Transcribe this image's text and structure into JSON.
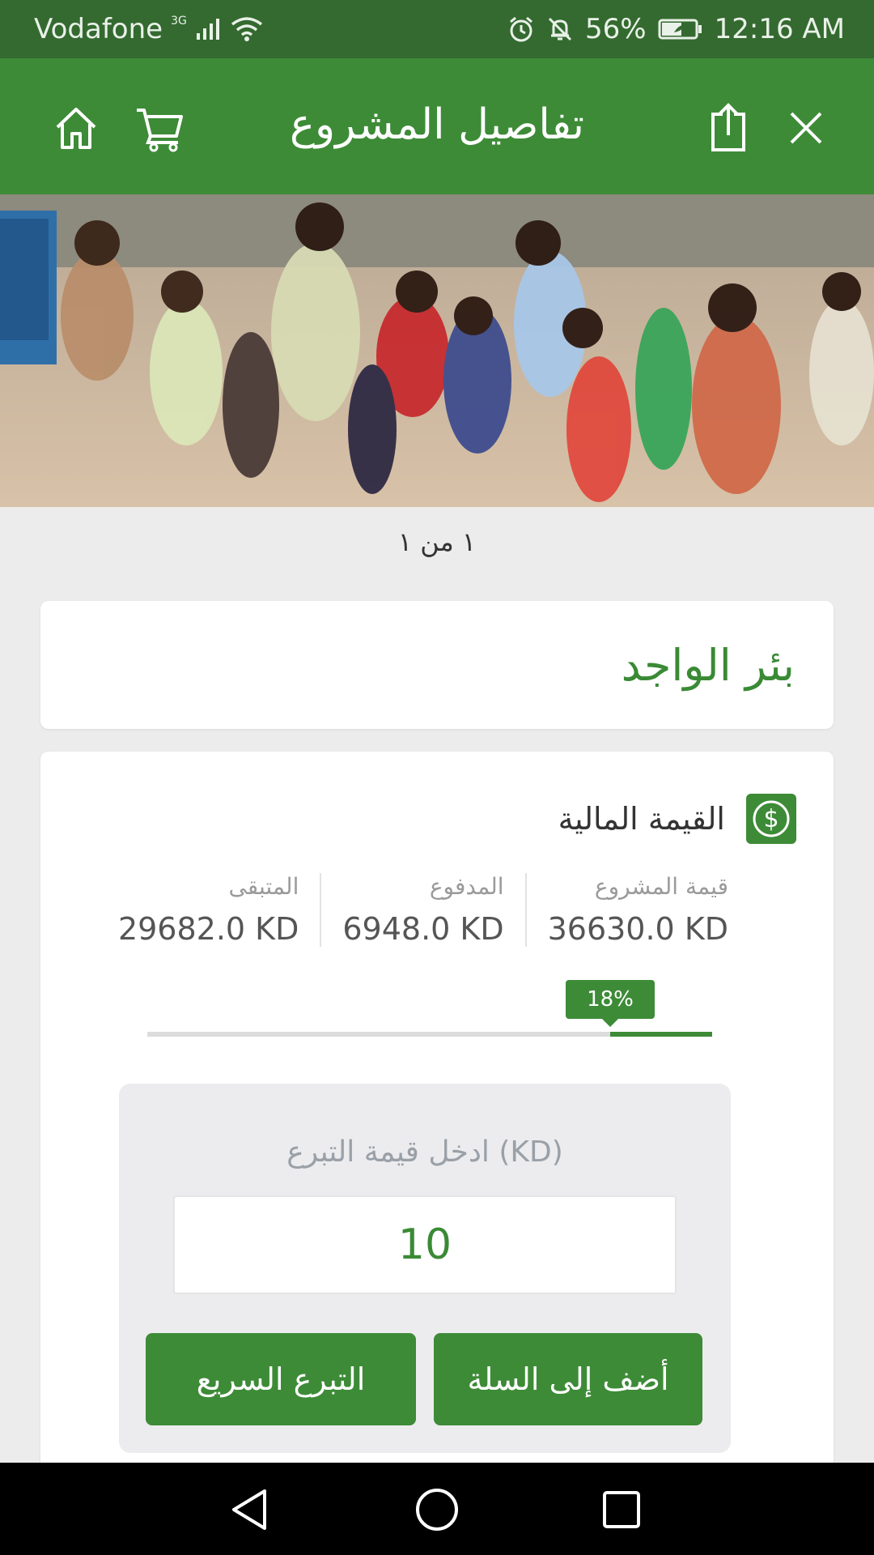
{
  "status_bar": {
    "carrier": "Vodafone",
    "network": "3G",
    "battery": "56%",
    "time": "12:16 AM"
  },
  "app_bar": {
    "title": "تفاصيل المشروع",
    "icons": [
      "home-icon",
      "cart-icon",
      "share-icon",
      "close-icon"
    ]
  },
  "gallery": {
    "pager": "١ من ١"
  },
  "project": {
    "title": "بئر الواجد"
  },
  "finance": {
    "title": "القيمة المالية",
    "stats": [
      {
        "label": "قيمة المشروع",
        "value": "36630.0 KD"
      },
      {
        "label": "المدفوع",
        "value": "6948.0 KD"
      },
      {
        "label": "المتبقى",
        "value": "29682.0 KD"
      }
    ],
    "progress_label": "18%",
    "progress_fraction": 0.18
  },
  "donation": {
    "label": "ادخل قيمة التبرع (KD)",
    "value": "10",
    "add_to_cart_label": "أضف إلى السلة",
    "quick_donate_label": "التبرع السريع"
  },
  "colors": {
    "status_bar": "#346a30",
    "primary": "#3d8b37",
    "background": "#ececec"
  }
}
